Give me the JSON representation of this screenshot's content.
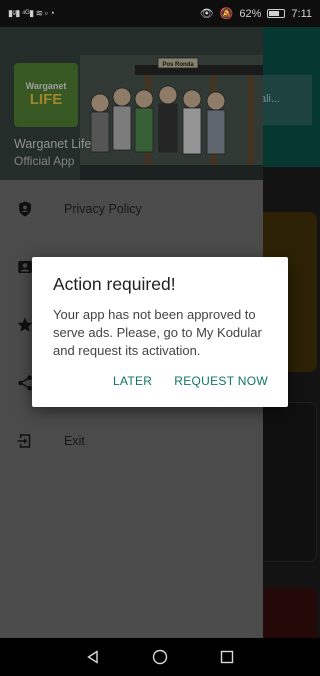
{
  "status_bar": {
    "left_indicators": "▮ᵍ▮ ⁴ᴳ▮ ≋ ▫ ◔",
    "battery_percent": "62%",
    "time": "7:11"
  },
  "background": {
    "search_hint": "ali..."
  },
  "drawer": {
    "header": {
      "logo_line1": "Warganet",
      "logo_line2": "LIFE",
      "sign_text": "Pos Ronda",
      "app_name": "Warganet Life",
      "app_subtitle": "Official App"
    },
    "items": [
      {
        "label": "Privacy Policy",
        "icon": "shield-icon"
      },
      {
        "label": "",
        "icon": "contact-card-icon"
      },
      {
        "label": "",
        "icon": "star-icon"
      },
      {
        "label": "",
        "icon": "share-icon"
      },
      {
        "label": "Exit",
        "icon": "exit-icon"
      }
    ]
  },
  "dialog": {
    "title": "Action required!",
    "message": "Your app has not been approved to serve ads. Please, go to My Kodular and request its activation.",
    "later_label": "LATER",
    "request_label": "REQUEST NOW",
    "accent_color": "#0e7564"
  },
  "nav_bar": {
    "back_icon": "back-triangle-icon",
    "home_icon": "home-circle-icon",
    "recents_icon": "recents-square-icon"
  }
}
